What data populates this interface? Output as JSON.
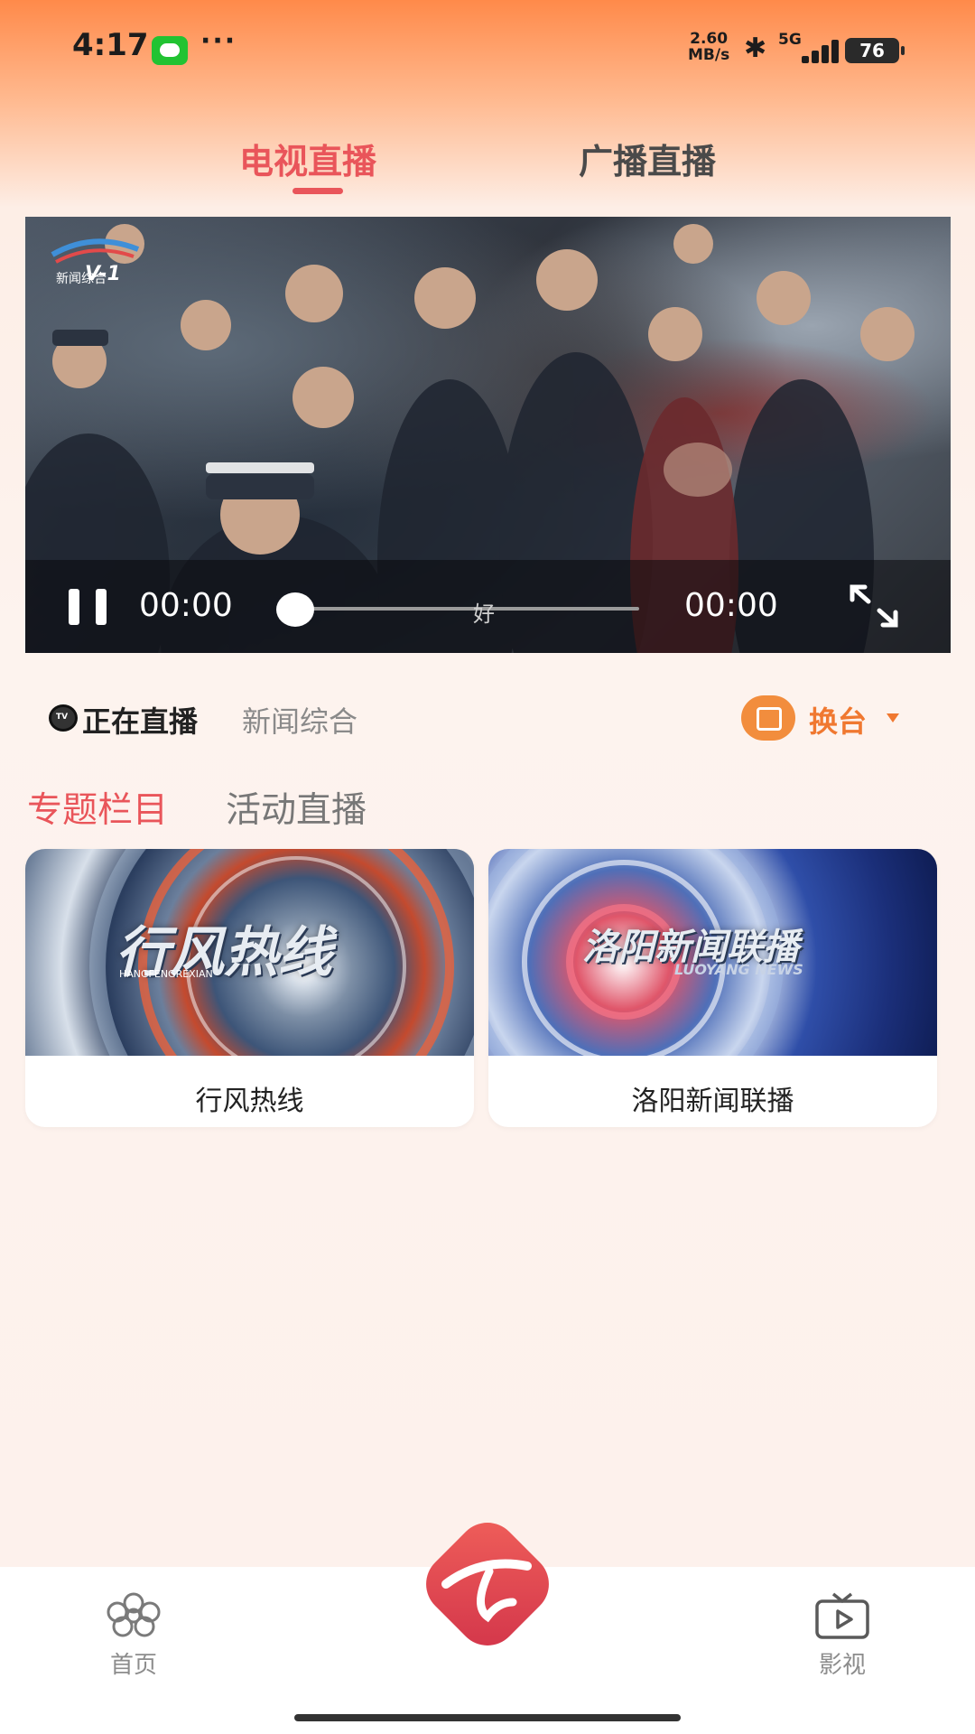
{
  "status_bar": {
    "time": "4:17",
    "dots": "···",
    "speed_value": "2.60",
    "speed_unit": "MB/s",
    "network": "5G",
    "battery": "76"
  },
  "top_tabs": [
    {
      "label": "电视直播",
      "active": true
    },
    {
      "label": "广播直播",
      "active": false
    }
  ],
  "video": {
    "channel_logo_text": "新闻综合",
    "channel_logo_mark": "V-1",
    "current_time": "00:00",
    "total_time": "00:00",
    "subtitle": "好",
    "progress": 0
  },
  "live": {
    "label": "正在直播",
    "channel": "新闻综合",
    "switch_label": "换台"
  },
  "section_tabs": [
    {
      "label": "专题栏目",
      "active": true
    },
    {
      "label": "活动直播",
      "active": false
    }
  ],
  "cards": [
    {
      "title": "行风热线",
      "image_text": "行风热线",
      "image_subtext": "HANGFENGREXIAN"
    },
    {
      "title": "洛阳新闻联播",
      "image_text": "洛阳新闻联播",
      "image_subtext": "LUOYANG NEWS"
    }
  ],
  "bottom_nav": {
    "home": "首页",
    "video": "影视"
  },
  "colors": {
    "accent": "#e9555a",
    "orange": "#f07830"
  }
}
